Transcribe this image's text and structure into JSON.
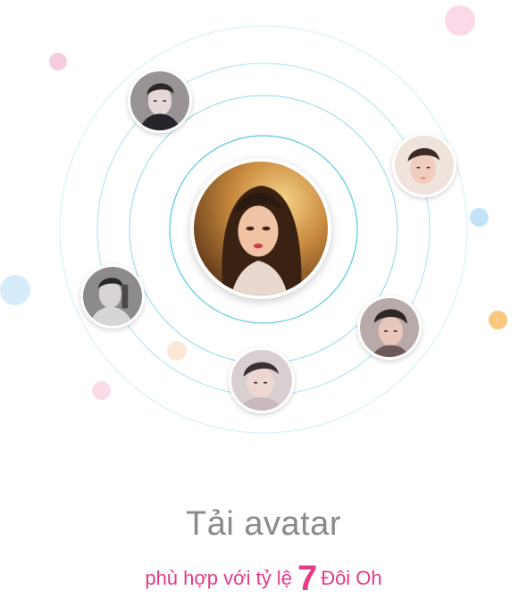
{
  "intro": {
    "title": "Tải avatar",
    "subtitle_before": "phù hợp với tỷ lệ",
    "subtitle_number": "7",
    "subtitle_after": "Đôi Oh"
  },
  "colors": {
    "accent": "#e53a86",
    "title_gray": "#8a8a8a",
    "ring": "#5fcbe6",
    "dot_pink": "#f7c8dd",
    "dot_blue": "#bfe3f7",
    "dot_orange": "#f8c77e",
    "dot_peach": "#fbe3cf"
  },
  "avatars": [
    {
      "name": "main-avatar",
      "icon": "female-portrait"
    },
    {
      "name": "avatar-1",
      "icon": "male-portrait"
    },
    {
      "name": "avatar-2",
      "icon": "male-portrait"
    },
    {
      "name": "avatar-3",
      "icon": "male-portrait"
    },
    {
      "name": "avatar-4",
      "icon": "male-portrait"
    },
    {
      "name": "avatar-5",
      "icon": "male-portrait"
    }
  ]
}
